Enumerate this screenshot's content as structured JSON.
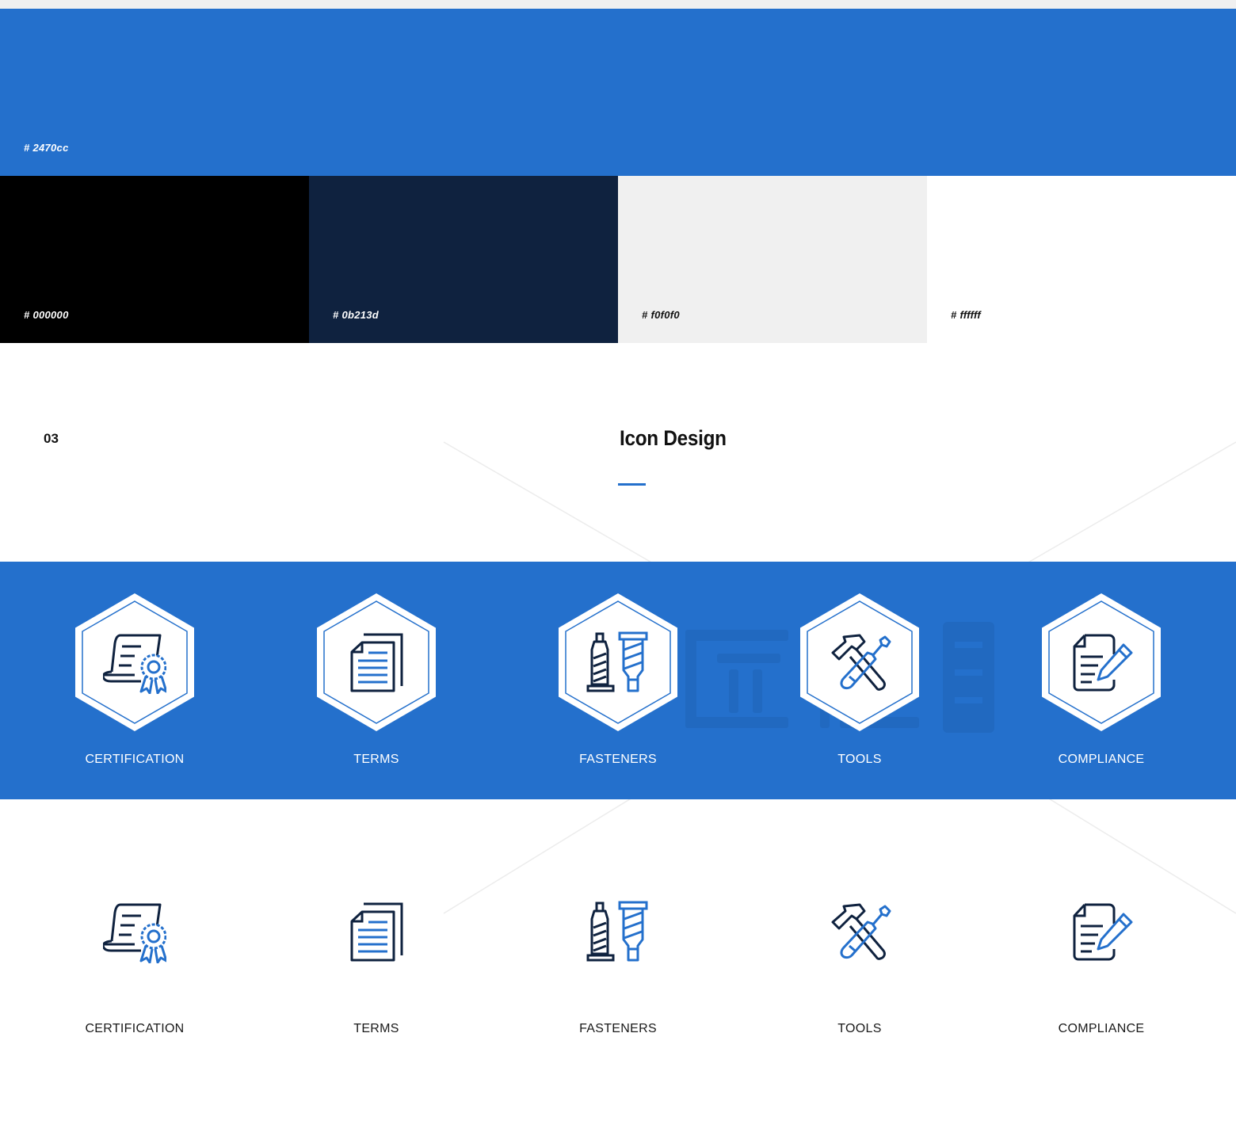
{
  "palette": {
    "primary": {
      "hex_label": "# 2470cc",
      "color": "#2470cc",
      "label_color": "#ffffff"
    },
    "swatches": [
      {
        "hex_label": "# 000000",
        "color": "#000000",
        "label_color": "#ffffff"
      },
      {
        "hex_label": "# 0b213d",
        "color": "#0f223f",
        "label_color": "#ffffff"
      },
      {
        "hex_label": "# f0f0f0",
        "color": "#f0f0f0",
        "label_color": "#111111"
      },
      {
        "hex_label": "# ffffff",
        "color": "#ffffff",
        "label_color": "#111111"
      }
    ]
  },
  "section": {
    "number": "03",
    "title": "Icon Design",
    "accent": "#2470cc"
  },
  "icons": [
    {
      "id": "certification",
      "label": "CERTIFICATION",
      "icon": "certificate-icon"
    },
    {
      "id": "terms",
      "label": "TERMS",
      "icon": "documents-icon"
    },
    {
      "id": "fasteners",
      "label": "FASTENERS",
      "icon": "fasteners-icon"
    },
    {
      "id": "tools",
      "label": "TOOLS",
      "icon": "hammer-screwdriver-icon"
    },
    {
      "id": "compliance",
      "label": "COMPLIANCE",
      "icon": "document-pen-icon"
    }
  ],
  "colors": {
    "icon_dark": "#0f223f",
    "icon_accent": "#2470cc",
    "band": "#2470cc"
  }
}
